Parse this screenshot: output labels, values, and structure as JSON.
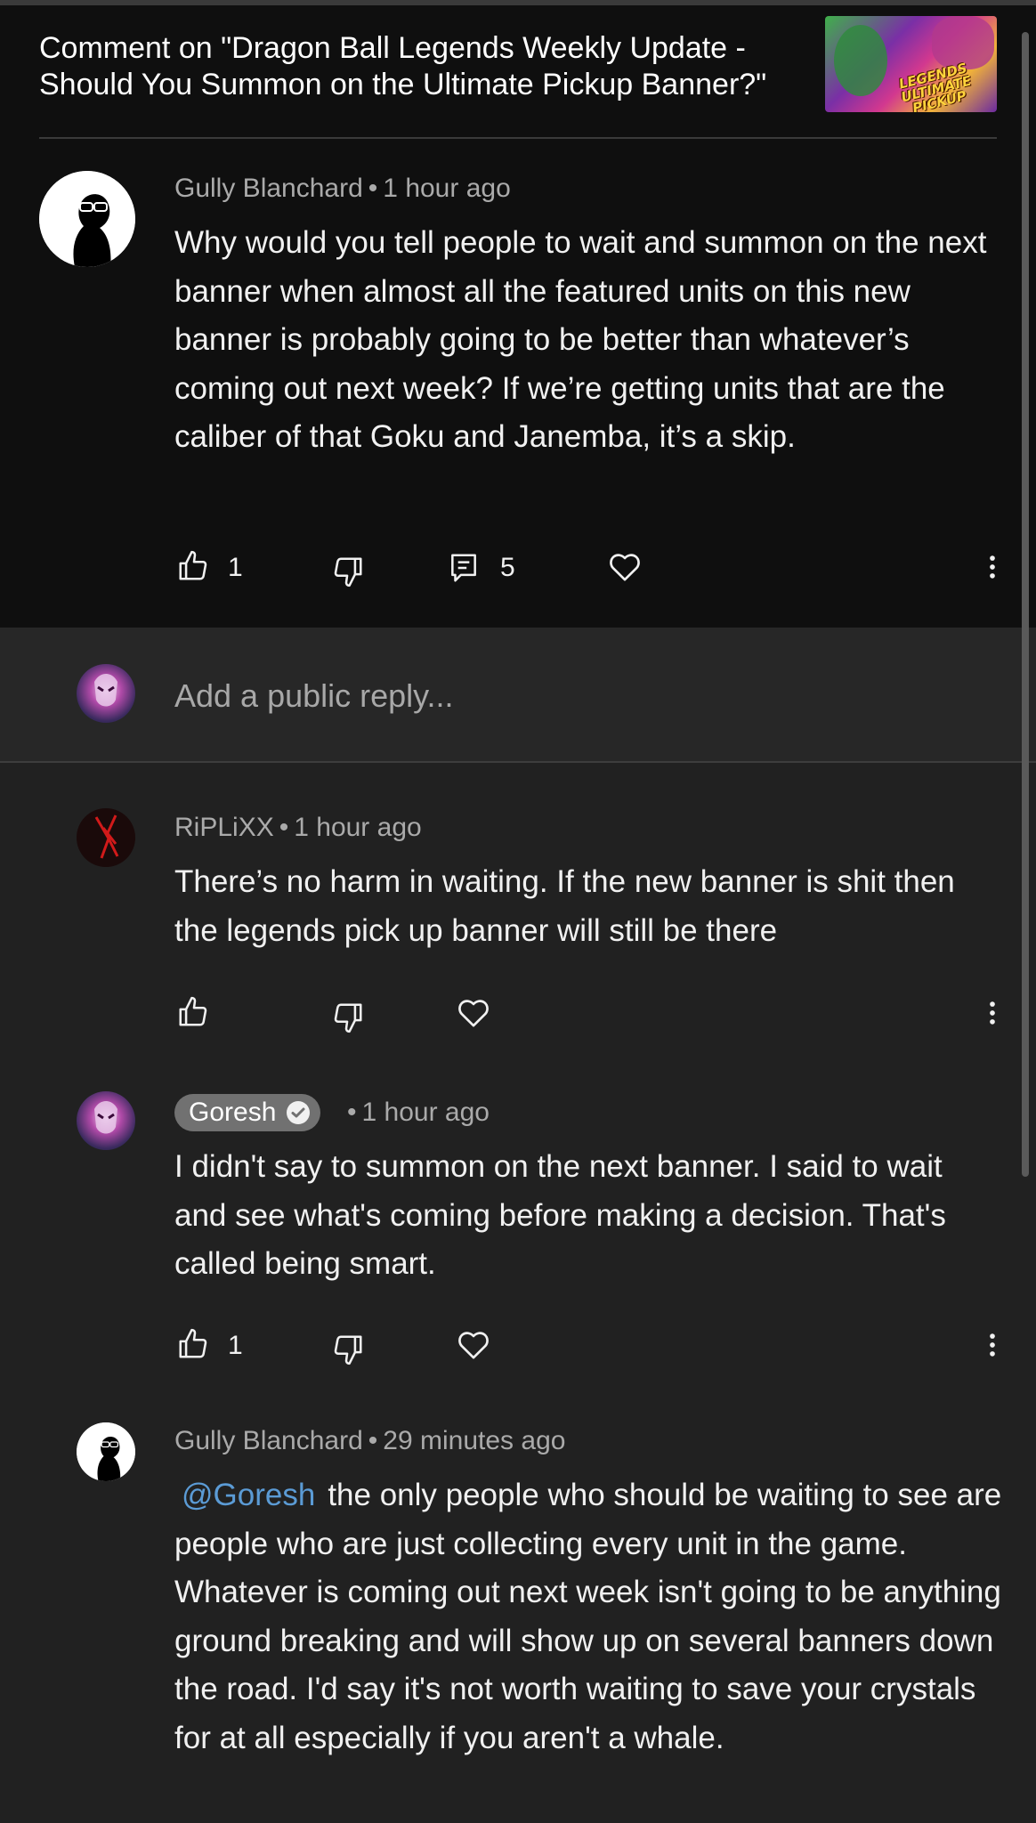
{
  "header": {
    "title": "Comment on \"Dragon Ball Legends Weekly Update - Should You Summon on the Ultimate Pickup Banner?\"",
    "thumbnail_text": "LEGENDS ULTIMATE PICKUP"
  },
  "main_comment": {
    "author": "Gully Blanchard",
    "time": "1 hour ago",
    "text": "Why would you tell people to wait and summon on the next banner when almost all the featured units on this new banner is probably going to be better than whatever’s coming out next week? If we’re getting units that are the caliber of that Goku and Janemba, it’s a skip.",
    "likes": "1",
    "replies_count": "5"
  },
  "reply_box": {
    "placeholder": "Add a public reply..."
  },
  "replies": [
    {
      "author": "RiPLiXX",
      "time": "1 hour ago",
      "text": "There’s no harm in waiting. If the new banner is shit then the legends pick up banner will still be there",
      "likes": ""
    },
    {
      "author": "Goresh",
      "time": "1 hour ago",
      "text": "I didn't say to summon on the next banner. I said to wait and see what's coming before making a decision. That's called being smart.",
      "likes": "1"
    },
    {
      "author": "Gully Blanchard",
      "time": "29 minutes ago",
      "mention": "@Goresh",
      "text": "the only people who should be waiting to see are people who are just collecting every unit in the game. Whatever is coming out next week isn't going to be anything ground breaking and will show up on several banners down the road. I'd say it's not worth waiting to save your crystals for at all especially if you aren't a whale."
    }
  ],
  "separator": "•",
  "icons": {
    "like": "thumbs-up-icon",
    "dislike": "thumbs-down-icon",
    "reply": "comment-icon",
    "heart": "heart-icon",
    "more": "more-vert-icon",
    "verified": "check-circle-icon"
  },
  "colors": {
    "background": "#212121",
    "header_background": "#0f0f0f",
    "mention": "#5b9bd5",
    "badge": "#717171"
  }
}
